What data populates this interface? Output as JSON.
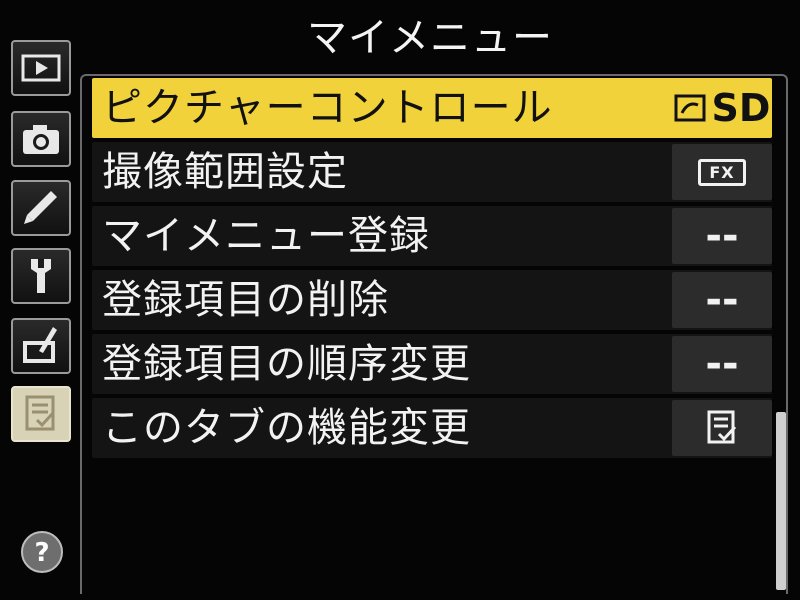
{
  "header": {
    "title": "マイメニュー"
  },
  "sidebar": {
    "tabs": [
      {
        "icon": "playback-icon"
      },
      {
        "icon": "camera-icon"
      },
      {
        "icon": "pencil-icon"
      },
      {
        "icon": "wrench-icon"
      },
      {
        "icon": "retouch-icon"
      },
      {
        "icon": "my-menu-icon"
      }
    ],
    "help": "?"
  },
  "menu": {
    "items": [
      {
        "label": "ピクチャーコントロール",
        "value": "SD",
        "selected": true
      },
      {
        "label": "撮像範囲設定",
        "value": "FX"
      },
      {
        "label": "マイメニュー登録",
        "value": "--"
      },
      {
        "label": "登録項目の削除",
        "value": "--"
      },
      {
        "label": "登録項目の順序変更",
        "value": "--"
      },
      {
        "label": "このタブの機能変更",
        "value_icon": "my-menu-icon"
      }
    ]
  },
  "colors": {
    "accent": "#f2d23a",
    "background": "#050505",
    "row": "#141414"
  }
}
